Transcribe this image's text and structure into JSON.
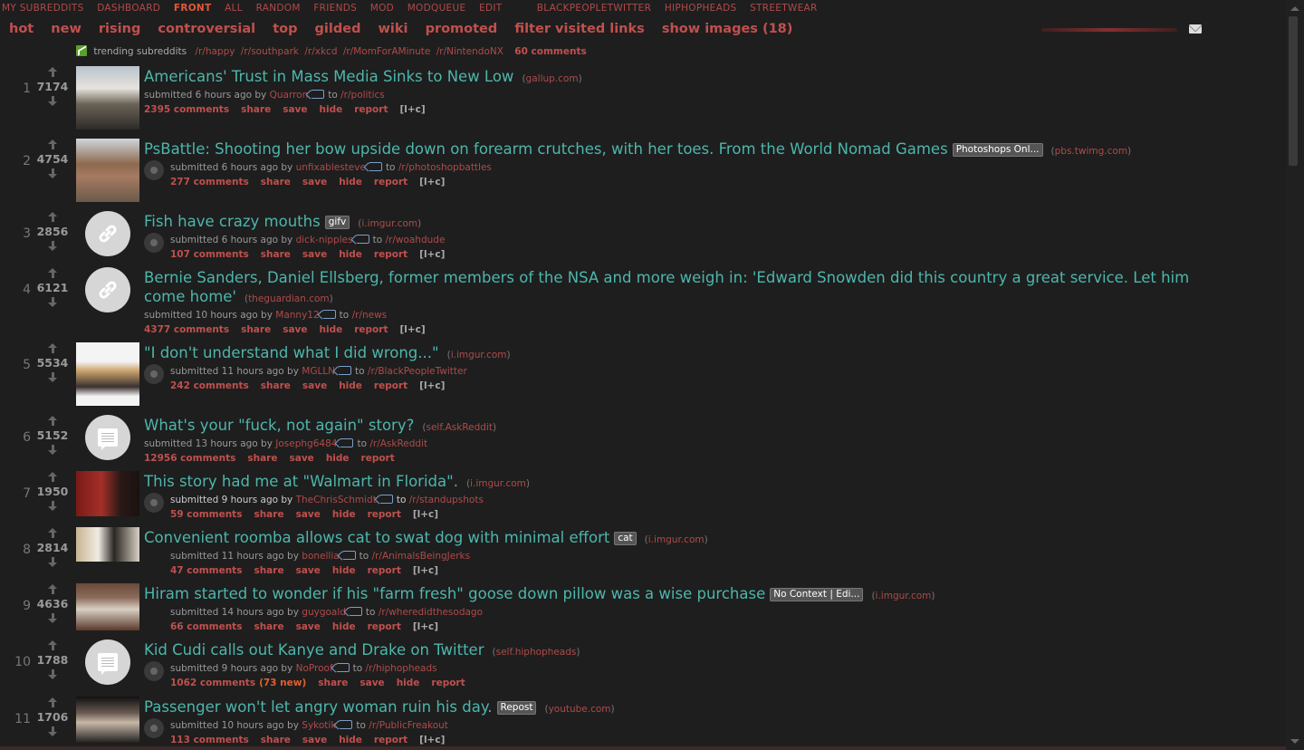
{
  "topbar": {
    "items": [
      "MY SUBREDDITS",
      "DASHBOARD",
      "FRONT",
      "ALL",
      "RANDOM",
      "FRIENDS",
      "MOD",
      "MODQUEUE",
      "EDIT"
    ],
    "subs": [
      "BLACKPEOPLETWITTER",
      "HIPHOPHEADS",
      "STREETWEAR"
    ],
    "active": "FRONT"
  },
  "sortbar": {
    "items": [
      "hot",
      "new",
      "rising",
      "controversial",
      "top",
      "gilded",
      "wiki",
      "promoted",
      "filter visited links",
      "show images (18)"
    ]
  },
  "trending": {
    "label": "trending subreddits",
    "subs": [
      "/r/happy",
      "/r/southpark",
      "/r/xkcd",
      "/r/MomForAMinute",
      "/r/NintendoNX"
    ],
    "comments": "60 comments"
  },
  "posts": [
    {
      "rank": "1",
      "score": "7174",
      "title": "Americans' Trust in Mass Media Sinks to New Low",
      "flair": "",
      "domain": "gallup.com",
      "age": "submitted 6 hours ago by",
      "author": "Quarron",
      "to": "to",
      "subreddit": "/r/politics",
      "comments": "2395 comments",
      "new": "",
      "expando": "[l+c]"
    },
    {
      "rank": "2",
      "score": "4754",
      "title": "PsBattle: Shooting her bow upside down on forearm crutches, with her toes. From the World Nomad Games",
      "flair": "Photoshops Onl...",
      "domain": "pbs.twimg.com",
      "age": "submitted 6 hours ago by",
      "author": "unfixablesteve",
      "to": "to",
      "subreddit": "/r/photoshopbattles",
      "comments": "277 comments",
      "new": "",
      "expando": "[l+c]"
    },
    {
      "rank": "3",
      "score": "2856",
      "title": "Fish have crazy mouths",
      "flair": "gifv",
      "domain": "i.imgur.com",
      "age": "submitted 6 hours ago by",
      "author": "dick-nipples",
      "to": "to",
      "subreddit": "/r/woahdude",
      "comments": "107 comments",
      "new": "",
      "expando": "[l+c]"
    },
    {
      "rank": "4",
      "score": "6121",
      "title": "Bernie Sanders, Daniel Ellsberg, former members of the NSA and more weigh in: 'Edward Snowden did this country a great service. Let him come home'",
      "flair": "",
      "domain": "theguardian.com",
      "age": "submitted 10 hours ago by",
      "author": "Manny12",
      "to": "to",
      "subreddit": "/r/news",
      "comments": "4377 comments",
      "new": "",
      "expando": "[l+c]"
    },
    {
      "rank": "5",
      "score": "5534",
      "title": "\"I don't understand what I did wrong...\"",
      "flair": "",
      "domain": "i.imgur.com",
      "age": "submitted 11 hours ago by",
      "author": "MGLLN",
      "to": "to",
      "subreddit": "/r/BlackPeopleTwitter",
      "comments": "242 comments",
      "new": "",
      "expando": "[l+c]"
    },
    {
      "rank": "6",
      "score": "5152",
      "title": "What's your \"fuck, not again\" story?",
      "flair": "",
      "domain": "self.AskReddit",
      "age": "submitted 13 hours ago by",
      "author": "Josephg6484",
      "to": "to",
      "subreddit": "/r/AskReddit",
      "comments": "12956 comments",
      "new": "",
      "expando": ""
    },
    {
      "rank": "7",
      "score": "1950",
      "title": "This story had me at \"Walmart in Florida\".",
      "flair": "",
      "domain": "i.imgur.com",
      "age": "submitted 9 hours ago by",
      "author": "TheChrisSchmidt",
      "to": "to",
      "subreddit": "/r/standupshots",
      "comments": "59 comments",
      "new": "",
      "expando": "[l+c]"
    },
    {
      "rank": "8",
      "score": "2814",
      "title": "Convenient roomba allows cat to swat dog with minimal effort",
      "flair": "cat",
      "domain": "i.imgur.com",
      "age": "submitted 11 hours ago by",
      "author": "bonellia",
      "to": "to",
      "subreddit": "/r/AnimalsBeingJerks",
      "comments": "47 comments",
      "new": "",
      "expando": "[l+c]"
    },
    {
      "rank": "9",
      "score": "4636",
      "title": "Hiram started to wonder if his \"farm fresh\" goose down pillow was a wise purchase",
      "flair": "No Context | Edi...",
      "domain": "i.imgur.com",
      "age": "submitted 14 hours ago by",
      "author": "guygoald",
      "to": "to",
      "subreddit": "/r/wheredidthesodago",
      "comments": "66 comments",
      "new": "",
      "expando": "[l+c]"
    },
    {
      "rank": "10",
      "score": "1788",
      "title": "Kid Cudi calls out Kanye and Drake on Twitter",
      "flair": "",
      "domain": "self.hiphopheads",
      "age": "submitted 9 hours ago by",
      "author": "NoProof",
      "to": "to",
      "subreddit": "/r/hiphopheads",
      "comments": "1062 comments",
      "new": "(73 new)",
      "expando": ""
    },
    {
      "rank": "11",
      "score": "1706",
      "title": "Passenger won't let angry woman ruin his day.",
      "flair": "Repost",
      "domain": "youtube.com",
      "age": "submitted 10 hours ago by",
      "author": "Sykotik",
      "to": "to",
      "subreddit": "/r/PublicFreakout",
      "comments": "113 comments",
      "new": "",
      "expando": "[l+c]"
    }
  ],
  "actions": {
    "share": "share",
    "save": "save",
    "hide": "hide",
    "report": "report"
  },
  "colors": {
    "background": "#1e1e1e",
    "title": "#4db6ac",
    "accent": "#c0504d",
    "link_red": "#b04a4a"
  }
}
